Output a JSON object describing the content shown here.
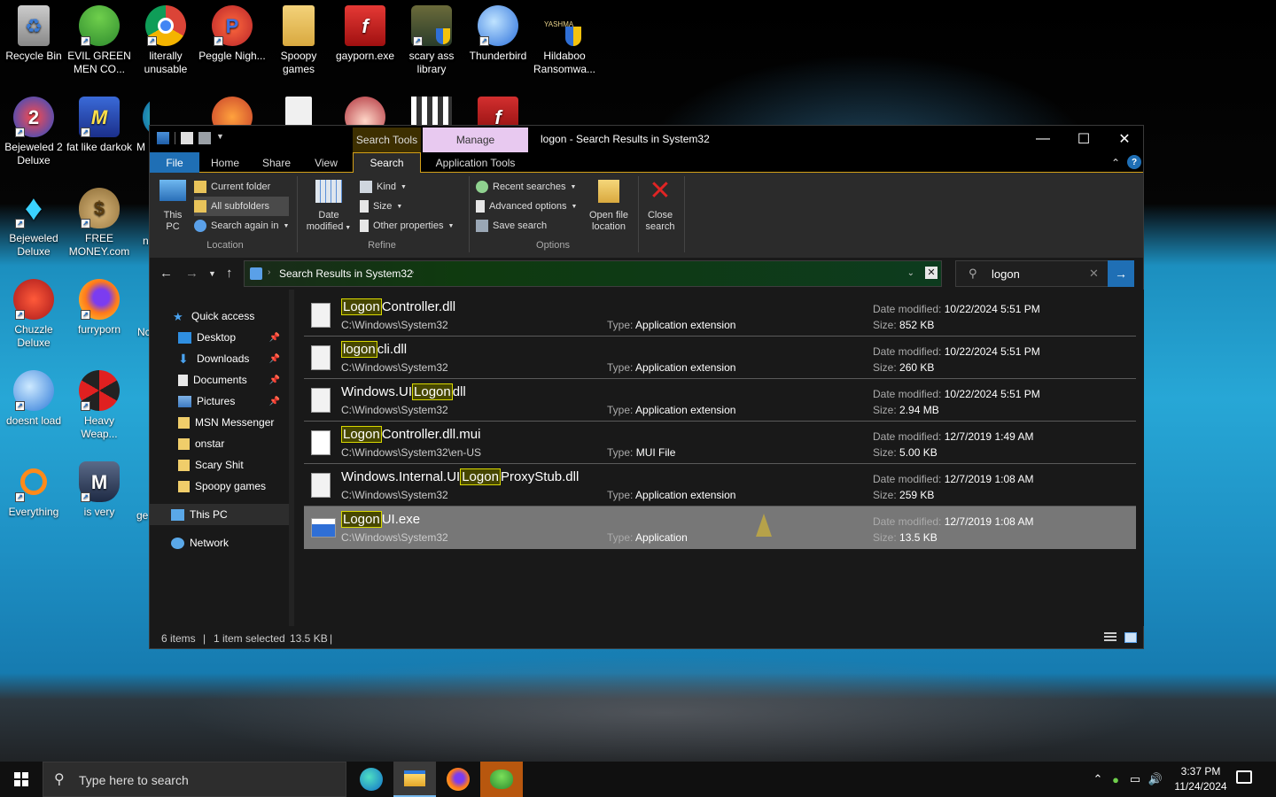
{
  "desktop": {
    "icons": [
      {
        "label": "Recycle Bin"
      },
      {
        "label": "EVIL GREEN MEN CO..."
      },
      {
        "label": "literally unusable"
      },
      {
        "label": "Peggle Nigh..."
      },
      {
        "label": "Spoopy games"
      },
      {
        "label": "gayporn.exe"
      },
      {
        "label": "scary ass library"
      },
      {
        "label": "Thunderbird"
      },
      {
        "label": "Hildaboo Ransomwa..."
      },
      {
        "label": "Bejeweled 2 Deluxe"
      },
      {
        "label": "fat like darkok"
      },
      {
        "label": "Bejeweled Deluxe"
      },
      {
        "label": "FREE MONEY.com"
      },
      {
        "label": "Chuzzle Deluxe"
      },
      {
        "label": "furryporn"
      },
      {
        "label": "doesnt load"
      },
      {
        "label": "Heavy Weap..."
      },
      {
        "label": "Everything"
      },
      {
        "label": "is very"
      }
    ],
    "partial_labels": [
      "M",
      "n",
      "Nc",
      "ge"
    ],
    "hildaboo_badge": "YASHMA"
  },
  "window": {
    "title": "logon - Search Results in System32",
    "context_tabs": {
      "search_tools": "Search Tools",
      "manage": "Manage"
    },
    "tabs": [
      "File",
      "Home",
      "Share",
      "View",
      "Search",
      "Application Tools"
    ],
    "ribbon": {
      "this_pc": "This PC",
      "current_folder": "Current folder",
      "all_subfolders": "All subfolders",
      "search_again": "Search again in",
      "location_label": "Location",
      "date_modified": "Date modified",
      "kind": "Kind",
      "size": "Size",
      "other_properties": "Other properties",
      "refine_label": "Refine",
      "recent_searches": "Recent searches",
      "advanced_options": "Advanced options",
      "save_search": "Save search",
      "open_file_location": "Open file location",
      "close_search": "Close search",
      "options_label": "Options"
    },
    "address": {
      "breadcrumb": "Search Results in System32"
    },
    "search": {
      "value": "logon"
    },
    "nav": {
      "quick_access": "Quick access",
      "items": [
        "Desktop",
        "Downloads",
        "Documents",
        "Pictures",
        "MSN Messenger",
        "onstar",
        "Scary Shit",
        "Spoopy games"
      ],
      "this_pc": "This PC",
      "network": "Network"
    },
    "files": [
      {
        "pre": "",
        "hl": "Logon",
        "post": "Controller.dll",
        "path": "C:\\Windows\\System32",
        "type_key": "Type:",
        "type": "Application extension",
        "date_key": "Date modified:",
        "date": "10/22/2024 5:51 PM",
        "size_key": "Size:",
        "size": "852 KB"
      },
      {
        "pre": "",
        "hl": "logon",
        "post": "cli.dll",
        "path": "C:\\Windows\\System32",
        "type_key": "Type:",
        "type": "Application extension",
        "date_key": "Date modified:",
        "date": "10/22/2024 5:51 PM",
        "size_key": "Size:",
        "size": "260 KB"
      },
      {
        "pre": "Windows.UI",
        "hl": "Logon",
        "post": "dll",
        "path": "C:\\Windows\\System32",
        "type_key": "Type:",
        "type": "Application extension",
        "date_key": "Date modified:",
        "date": "10/22/2024 5:51 PM",
        "size_key": "Size:",
        "size": "2.94 MB"
      },
      {
        "pre": "",
        "hl": "Logon",
        "post": "Controller.dll.mui",
        "path": "C:\\Windows\\System32\\en-US",
        "type_key": "Type:",
        "type": "MUI File",
        "date_key": "Date modified:",
        "date": "12/7/2019 1:49 AM",
        "size_key": "Size:",
        "size": "5.00 KB"
      },
      {
        "pre": "Windows.Internal.UI",
        "hl": "Logon",
        "post": "ProxyStub.dll",
        "path": "C:\\Windows\\System32",
        "type_key": "Type:",
        "type": "Application extension",
        "date_key": "Date modified:",
        "date": "12/7/2019 1:08 AM",
        "size_key": "Size:",
        "size": "259 KB"
      },
      {
        "pre": "",
        "hl": "Logon",
        "post": "UI.exe",
        "path": "C:\\Windows\\System32",
        "type_key": "Type:",
        "type": "Application",
        "date_key": "Date modified:",
        "date": "12/7/2019 1:08 AM",
        "size_key": "Size:",
        "size": "13.5 KB"
      }
    ],
    "status": {
      "count": "6 items",
      "selected": "1 item selected",
      "size": "13.5 KB"
    }
  },
  "taskbar": {
    "search_placeholder": "Type here to search",
    "time": "3:37 PM",
    "date": "11/24/2024"
  },
  "colors": {
    "accent": "#d4a017",
    "selection": "#777777",
    "highlight_border": "#d8d800",
    "taskbar": "#101010"
  }
}
